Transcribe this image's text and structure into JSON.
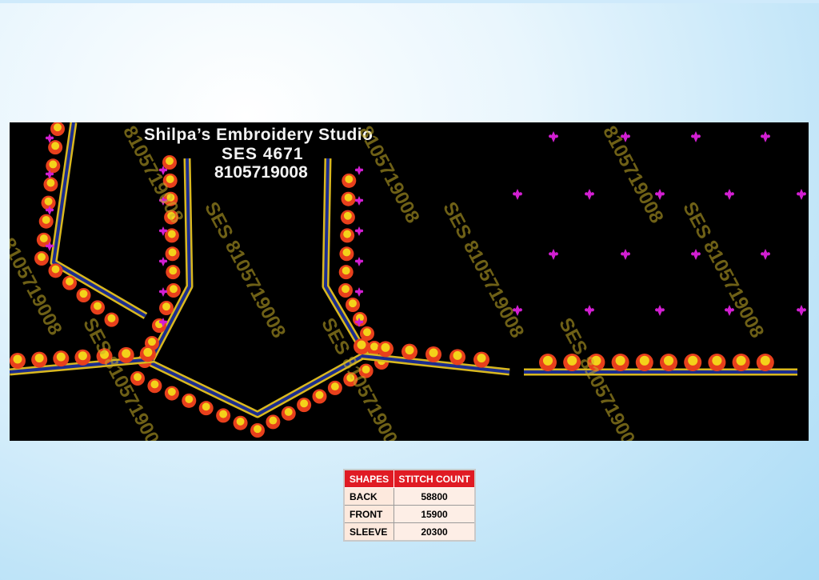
{
  "header": {
    "studio_name": "Shilpa’s Embroidery Studio",
    "design_code": "SES  4671",
    "phone": "8105719008"
  },
  "watermark_text": "SES 8105719008",
  "watermark_short": "8105719008",
  "colors": {
    "background": "#000000",
    "motif_red": "#e8401c",
    "motif_yellow": "#f4d21a",
    "accent_magenta": "#d21fd2",
    "border_blue": "#1b2d8f",
    "border_gold": "#d9b81f",
    "table_header": "#e01b24"
  },
  "table": {
    "headers": [
      "SHAPES",
      "STITCH COUNT"
    ],
    "rows": [
      {
        "shape": "BACK",
        "count": "58800"
      },
      {
        "shape": "FRONT",
        "count": "15900"
      },
      {
        "shape": "SLEEVE",
        "count": "20300"
      }
    ]
  }
}
